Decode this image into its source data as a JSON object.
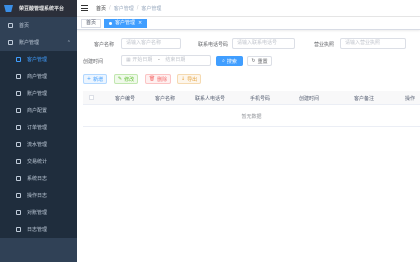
{
  "app": {
    "title": "荣豆酸管理系统平台"
  },
  "sidebar": {
    "items": [
      {
        "label": "首页",
        "icon": "home-icon"
      },
      {
        "label": "账户管理",
        "icon": "gear-icon",
        "expanded": true
      },
      {
        "label": "客户管理",
        "icon": "user-icon",
        "active": true
      },
      {
        "label": "商户管理",
        "icon": "shop-icon"
      },
      {
        "label": "账户管理",
        "icon": "wallet-icon"
      },
      {
        "label": "商户配置",
        "icon": "config-icon"
      },
      {
        "label": "订单管理",
        "icon": "order-icon"
      },
      {
        "label": "流水管理",
        "icon": "flow-icon"
      },
      {
        "label": "交易统计",
        "icon": "chart-icon"
      },
      {
        "label": "系统日志",
        "icon": "log-icon"
      },
      {
        "label": "操作日志",
        "icon": "log-icon"
      },
      {
        "label": "对账管理",
        "icon": "reconcile-icon"
      },
      {
        "label": "日志管理",
        "icon": "log-icon"
      }
    ]
  },
  "header": {
    "breadcrumb": [
      "首页",
      "客户管理",
      "客户管理"
    ]
  },
  "tags": [
    {
      "label": "首页",
      "active": false
    },
    {
      "label": "客户管理",
      "active": true,
      "close": "×"
    }
  ],
  "filters": {
    "customer_name": {
      "label": "客户名称",
      "placeholder": "请输入客户名称"
    },
    "contact_phone": {
      "label": "联系电话号码",
      "placeholder": "请输入联系电话号"
    },
    "business_no": {
      "label": "营业执照",
      "placeholder": "请输入营业执照"
    },
    "create_time": {
      "label": "创建时间",
      "start_placeholder": "开始日期",
      "separator": "-",
      "end_placeholder": "结束日期"
    },
    "search_label": "搜索",
    "reset_label": "重置"
  },
  "toolbar": {
    "add_label": "新增",
    "edit_label": "修改",
    "delete_label": "删除",
    "export_label": "导出"
  },
  "table": {
    "columns": [
      "客户编号",
      "客户名称",
      "联系人电话号",
      "手机号码",
      "创建时间",
      "客户备注",
      "操作"
    ],
    "empty_text": "暂无数据"
  },
  "colors": {
    "sidebar_bg": "#304156",
    "primary": "#409eff"
  }
}
